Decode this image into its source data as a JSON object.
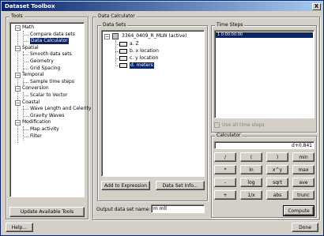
{
  "window": {
    "title": "Dataset Toolbox",
    "close_glyph": "X"
  },
  "tools": {
    "group_label": "Tools",
    "tree": [
      {
        "label": "Math",
        "level": 0,
        "expander": "−"
      },
      {
        "label": "Compare data sets",
        "level": 1
      },
      {
        "label": "Data Calculator",
        "level": 1,
        "selected": true
      },
      {
        "label": "Spatial",
        "level": 0,
        "expander": "−"
      },
      {
        "label": "Smooth data sets",
        "level": 1
      },
      {
        "label": "Geometry",
        "level": 1
      },
      {
        "label": "Grid Spacing",
        "level": 1
      },
      {
        "label": "Temporal",
        "level": 0,
        "expander": "−"
      },
      {
        "label": "Sample time steps",
        "level": 1
      },
      {
        "label": "Conversion",
        "level": 0,
        "expander": "−"
      },
      {
        "label": "Scalar to Vector",
        "level": 1
      },
      {
        "label": "Coastal",
        "level": 0,
        "expander": "−"
      },
      {
        "label": "Wave Length and Celerity",
        "level": 1
      },
      {
        "label": "Gravity Waves",
        "level": 1
      },
      {
        "label": "Modification",
        "level": 0,
        "expander": "−"
      },
      {
        "label": "Map activity",
        "level": 1
      },
      {
        "label": "Filter",
        "level": 1
      }
    ],
    "update_button": "Update Available Tools"
  },
  "calculator_panel": {
    "group_label": "Data Calculator",
    "datasets_label": "Data Sets",
    "root_item": {
      "label": "3364_0409_R_MLW (active)",
      "expander": "−"
    },
    "datasets": [
      {
        "label": "a. Z",
        "icon": "scalar-dataset-icon"
      },
      {
        "label": "b. x location",
        "icon": "scalar-dataset-icon"
      },
      {
        "label": "c. y location",
        "icon": "scalar-dataset-icon"
      },
      {
        "label": "d. meters",
        "icon": "scalar-dataset-icon",
        "selected": true
      }
    ],
    "add_expression_button": "Add to Expression",
    "dataset_info_button": "Data Set Info...",
    "output_label": "Output data set name:",
    "output_value": "m mll"
  },
  "time_steps": {
    "group_label": "Time Steps",
    "items": [
      "1  0:00:00:00"
    ],
    "use_all_label": "Use all time steps"
  },
  "calculator": {
    "group_label": "Calculator",
    "expression": "d+0.841",
    "keys": [
      [
        "/",
        "(",
        ")",
        "min"
      ],
      [
        "*",
        "ln",
        "x^y",
        "max"
      ],
      [
        "-",
        "log",
        "sqrt",
        "ave"
      ],
      [
        "+",
        "1/x",
        "abs",
        "trunc"
      ]
    ],
    "compute_button": "Compute"
  },
  "footer": {
    "help_button": "Help...",
    "done_button": "Done"
  }
}
